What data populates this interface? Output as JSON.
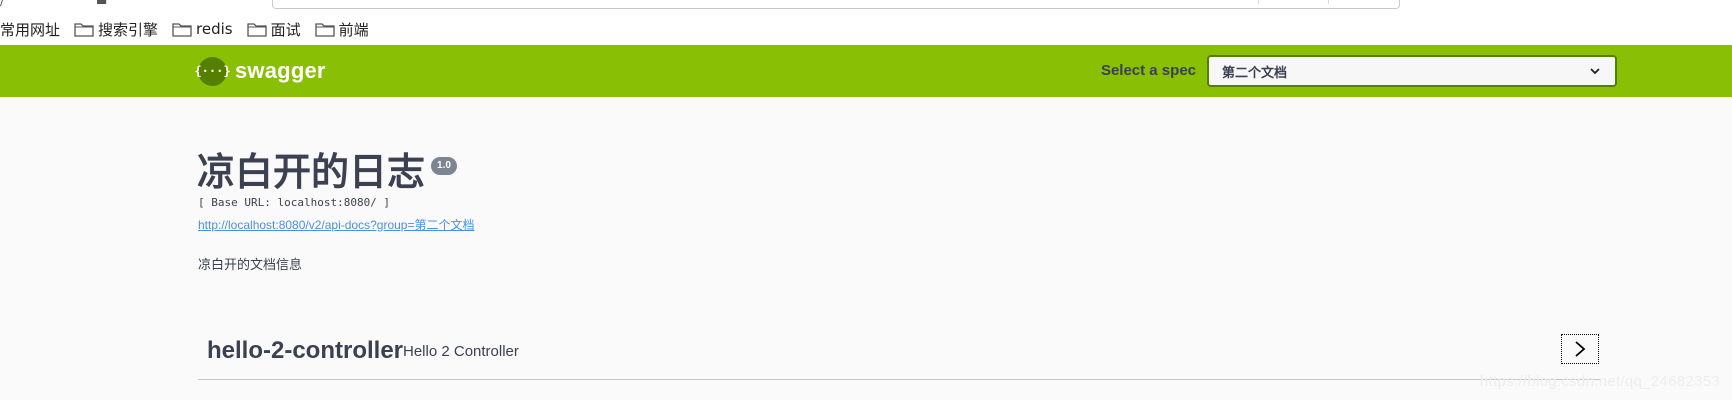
{
  "browser": {
    "bookmarks": [
      {
        "label": "常用网址",
        "has_folder": false
      },
      {
        "label": "搜索引擎",
        "has_folder": true
      },
      {
        "label": "redis",
        "has_folder": true
      },
      {
        "label": "面试",
        "has_folder": true
      },
      {
        "label": "前端",
        "has_folder": true
      }
    ]
  },
  "topbar": {
    "logo_glyph": "{···}",
    "brand": "swagger",
    "spec_label": "Select a spec",
    "spec_selected": "第二个文档",
    "accent_color": "#89bf04"
  },
  "info": {
    "title": "凉白开的日志",
    "version": "1.0",
    "base_url": "[ Base URL: localhost:8080/ ]",
    "api_docs_link": "http://localhost:8080/v2/api-docs?group=第二个文档",
    "description": "凉白开的文档信息"
  },
  "tags": [
    {
      "name": "hello-2-controller",
      "description": "Hello 2 Controller",
      "expand_icon": "chevron-right-icon"
    }
  ],
  "watermark": "https://blog.csdn.net/qq_24682353"
}
